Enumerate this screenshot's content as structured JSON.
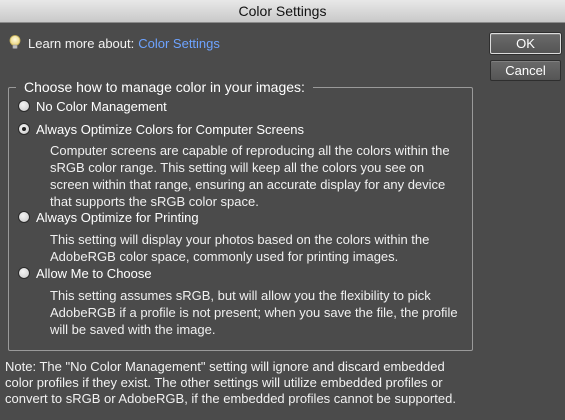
{
  "window": {
    "title": "Color Settings"
  },
  "learn_more": {
    "prefix": "Learn more about:",
    "link": "Color Settings",
    "icon": "lightbulb-icon"
  },
  "buttons": {
    "ok": "OK",
    "cancel": "Cancel"
  },
  "group": {
    "legend": "Choose how to manage color in your images:",
    "options": [
      {
        "label": "No Color Management",
        "selected": false,
        "description": ""
      },
      {
        "label": "Always Optimize Colors for Computer Screens",
        "selected": true,
        "description": "Computer screens are capable of reproducing all the colors within the sRGB color range. This setting will keep all the colors you see on screen within that range, ensuring an accurate display for any device that supports the sRGB color space."
      },
      {
        "label": "Always Optimize for Printing",
        "selected": false,
        "description": "This setting will display your photos based on the colors within the AdobeRGB color space, commonly used for printing images."
      },
      {
        "label": "Allow Me to Choose",
        "selected": false,
        "description": "This setting assumes sRGB, but will allow you the flexibility to pick AdobeRGB if a profile is not present; when you save the file, the profile will be saved with the image."
      }
    ]
  },
  "note": "Note: The \"No Color Management\" setting will ignore and discard embedded color profiles if they exist. The other settings will utilize embedded profiles or convert to sRGB or AdobeRGB, if the embedded profiles cannot be supported."
}
